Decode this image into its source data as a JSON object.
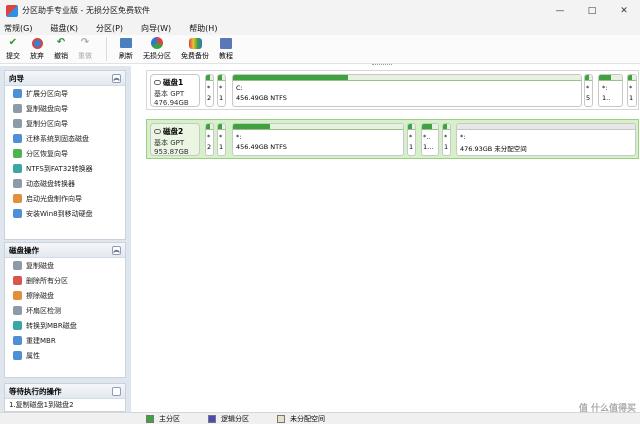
{
  "window": {
    "title": "分区助手专业版 - 无损分区免费软件",
    "controls": [
      "—",
      "□",
      "✕"
    ]
  },
  "menu": [
    "常规(G)",
    "磁盘(K)",
    "分区(P)",
    "向导(W)",
    "帮助(H)"
  ],
  "toolbar": {
    "submit": "提交",
    "discard": "放弃",
    "undo": "撤销",
    "redo": "重做",
    "refresh": "刷新",
    "lossless": "无损分区",
    "backup": "免费备份",
    "tutorial": "教程"
  },
  "wizard": {
    "title": "向导",
    "items": [
      "扩展分区向导",
      "复制磁盘向导",
      "复制分区向导",
      "迁移系统到固态磁盘",
      "分区恢复向导",
      "NTFS到FAT32转换器",
      "动态磁盘转换器",
      "启动光盘制作向导",
      "安装Win8到移动硬盘"
    ]
  },
  "disk_ops": {
    "title": "磁盘操作",
    "items": [
      "复制磁盘",
      "删除所有分区",
      "擦除磁盘",
      "坏扇区检测",
      "转换到MBR磁盘",
      "重建MBR",
      "属性"
    ]
  },
  "pending": {
    "title": "等待执行的操作",
    "items": [
      "1.复制磁盘1到磁盘2"
    ]
  },
  "disks": [
    {
      "name": "磁盘1",
      "type": "基本 GPT",
      "size": "476.94GB",
      "partitions": [
        {
          "label": "*",
          "sub": "2",
          "used_fraction": 0.6
        },
        {
          "label": "*",
          "sub": "1",
          "used_fraction": 0.6
        },
        {
          "label": "C:",
          "sub": "456.49GB NTFS",
          "used_fraction": 0.33
        },
        {
          "label": "*",
          "sub": "5",
          "used_fraction": 0.6
        },
        {
          "label": "*:",
          "sub": "1..",
          "used_fraction": 0.5
        },
        {
          "label": "*",
          "sub": "1",
          "used_fraction": 0.5
        }
      ]
    },
    {
      "name": "磁盘2",
      "type": "基本 GPT",
      "size": "953.87GB",
      "partitions": [
        {
          "label": "*",
          "sub": "2",
          "used_fraction": 0.6
        },
        {
          "label": "*",
          "sub": "1",
          "used_fraction": 0.6
        },
        {
          "label": "*:",
          "sub": "456.49GB NTFS",
          "used_fraction": 0.22
        },
        {
          "label": "*",
          "sub": "1",
          "used_fraction": 0.5
        },
        {
          "label": "*..",
          "sub": "1...",
          "used_fraction": 0.6
        },
        {
          "label": "*",
          "sub": "1",
          "used_fraction": 0.5
        },
        {
          "label": "*:",
          "sub": "476.93GB 未分配空间",
          "used_fraction": 0
        }
      ]
    }
  ],
  "legend": {
    "primary": "主分区",
    "logical": "逻辑分区",
    "unallocated": "未分配空间"
  },
  "colors": {
    "primary": "#3ea33e",
    "logical": "#4a4ab8",
    "unallocated": "#e6e2c8",
    "selected_row": "#d6f0c9"
  },
  "watermark": "值 什么值得买"
}
